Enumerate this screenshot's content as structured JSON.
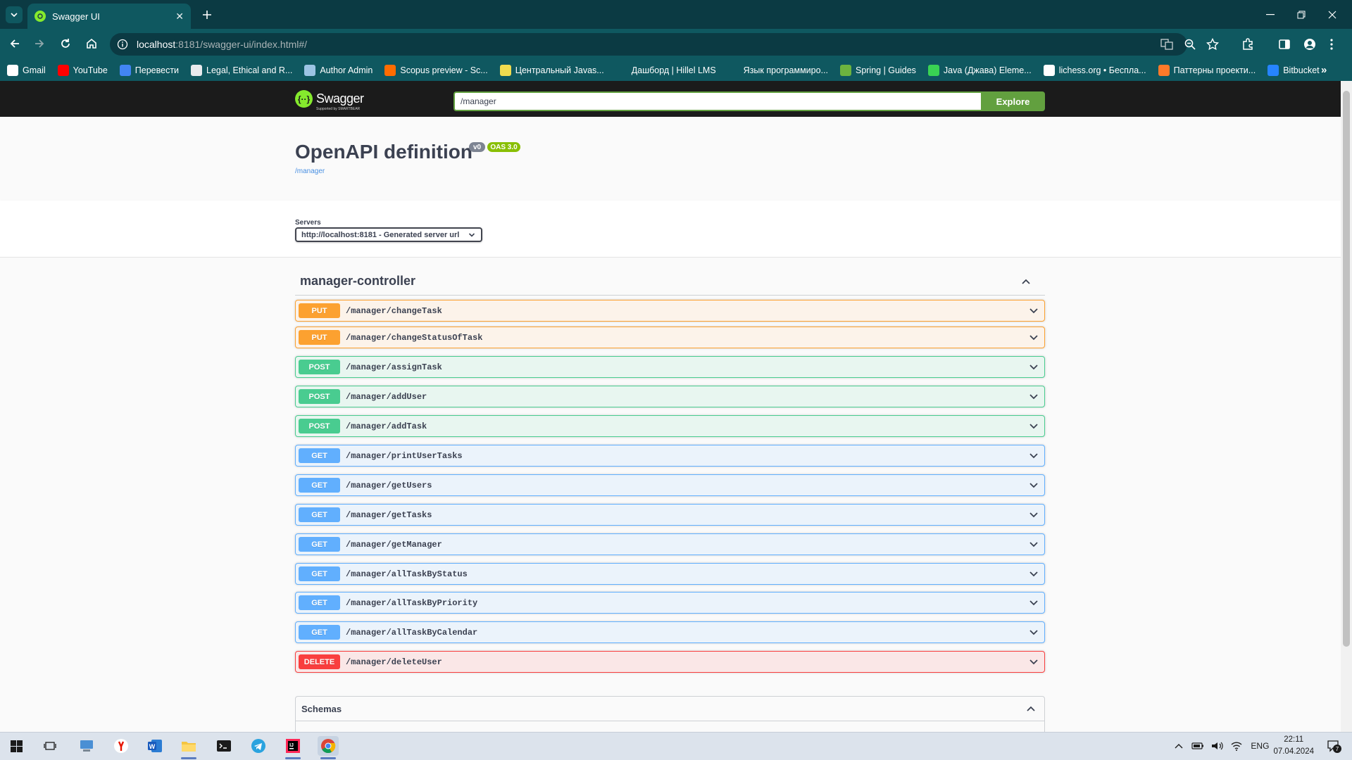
{
  "browser": {
    "tab_title": "Swagger UI",
    "url_host": "localhost",
    "url_path": ":8181/swagger-ui/index.html#/",
    "bookmarks": [
      {
        "label": "Gmail",
        "icon": "google-icon",
        "color": "#ffffff"
      },
      {
        "label": "YouTube",
        "icon": "youtube-icon",
        "color": "#ff0000"
      },
      {
        "label": "Перевести",
        "icon": "translate-icon",
        "color": "#4285f4"
      },
      {
        "label": "Legal, Ethical and R...",
        "icon": "globe-icon",
        "color": "#e8eaed"
      },
      {
        "label": "Author Admin",
        "icon": "cloud-icon",
        "color": "#9cc4e4"
      },
      {
        "label": "Scopus preview - Sc...",
        "icon": "scopus-icon",
        "color": "#ff6c00"
      },
      {
        "label": "Центральный Javas...",
        "icon": "javascript-icon",
        "color": "#f0db4f"
      },
      {
        "label": "Дашборд | Hillel LMS",
        "icon": "hillel-icon",
        "color": "#0f5860"
      },
      {
        "label": "Язык программиро...",
        "icon": "page-icon",
        "color": "#0f5860"
      },
      {
        "label": "Spring | Guides",
        "icon": "spring-icon",
        "color": "#6db33f"
      },
      {
        "label": "Java (Джава) Eleme...",
        "icon": "java-icon",
        "color": "#39d353"
      },
      {
        "label": "lichess.org • Беспла...",
        "icon": "lichess-icon",
        "color": "#ffffff"
      },
      {
        "label": "Паттерны проекти...",
        "icon": "refactoring-icon",
        "color": "#ff7a29"
      },
      {
        "label": "Bitbucket",
        "icon": "bitbucket-icon",
        "color": "#2684ff"
      }
    ]
  },
  "swagger": {
    "logo_word": "Swagger",
    "logo_sub": "Supported by SMARTBEAR",
    "explore_value": "/manager",
    "explore_label": "Explore",
    "title": "OpenAPI definition",
    "version": "v0",
    "oas": "OAS 3.0",
    "base_url": "/manager",
    "servers_label": "Servers",
    "server_value": "http://localhost:8181 - Generated server url",
    "tag": "manager-controller",
    "operations": [
      {
        "method": "PUT",
        "path": "/manager/changeTask"
      },
      {
        "method": "PUT",
        "path": "/manager/changeStatusOfTask"
      },
      {
        "method": "POST",
        "path": "/manager/assignTask"
      },
      {
        "method": "POST",
        "path": "/manager/addUser"
      },
      {
        "method": "POST",
        "path": "/manager/addTask"
      },
      {
        "method": "GET",
        "path": "/manager/printUserTasks"
      },
      {
        "method": "GET",
        "path": "/manager/getUsers"
      },
      {
        "method": "GET",
        "path": "/manager/getTasks"
      },
      {
        "method": "GET",
        "path": "/manager/getManager"
      },
      {
        "method": "GET",
        "path": "/manager/allTaskByStatus"
      },
      {
        "method": "GET",
        "path": "/manager/allTaskByPriority"
      },
      {
        "method": "GET",
        "path": "/manager/allTaskByCalendar"
      },
      {
        "method": "DELETE",
        "path": "/manager/deleteUser"
      }
    ],
    "schemas_label": "Schemas"
  },
  "taskbar": {
    "lang": "ENG",
    "time": "22:11",
    "date": "07.04.2024",
    "notifications": "7"
  }
}
